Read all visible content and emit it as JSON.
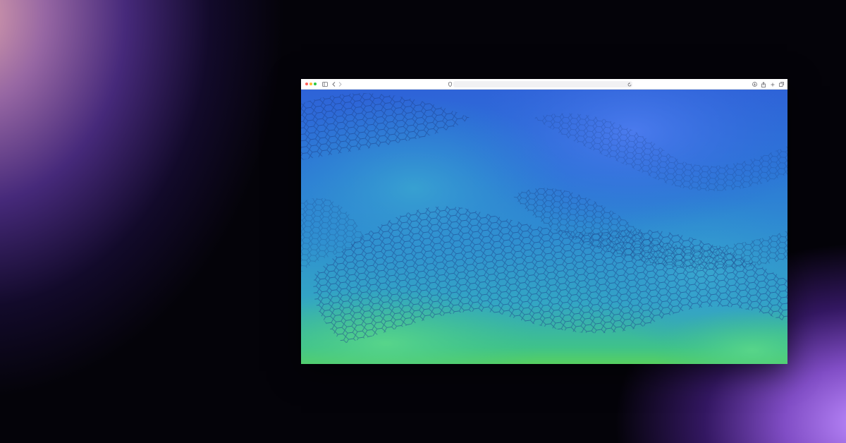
{
  "scene": {
    "background": {
      "base": "#040309",
      "glow_top_left": "#e8aab4",
      "glow_bottom_right": "#be8cff"
    }
  },
  "browser": {
    "toolbar": {
      "traffic_lights": {
        "close": "#ff5f57",
        "minimize": "#febc2e",
        "maximize": "#28c840"
      },
      "icons": [
        "sidebar-icon",
        "back-icon",
        "forward-icon",
        "shield-icon",
        "reload-icon",
        "download-icon",
        "share-icon",
        "add-tab-icon",
        "tabs-icon"
      ],
      "address_bar": {
        "text": ""
      }
    },
    "content": {
      "description_colors": [
        "#2e63d8",
        "#2f8fd0",
        "#33a6c4",
        "#56d060"
      ]
    }
  }
}
